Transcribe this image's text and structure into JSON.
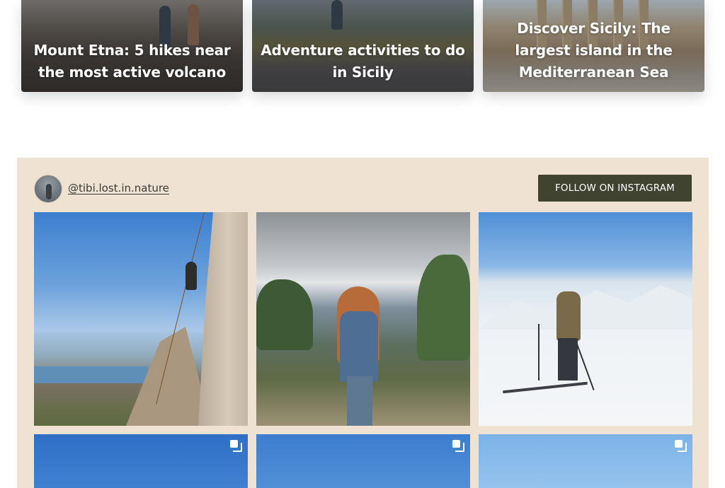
{
  "articles": [
    {
      "title": "Mount Etna: 5 hikes near the most active volcano"
    },
    {
      "title": "Adventure activities to do in Sicily"
    },
    {
      "title": "Discover Sicily: The largest island in the Mediterranean Sea"
    }
  ],
  "instagram": {
    "handle": "@tibi.lost.in.nature",
    "follow_label": "FOLLOW ON INSTAGRAM",
    "posts": [
      {
        "subject": "climber-on-rock",
        "multi": false
      },
      {
        "subject": "woman-long-hair-mountains",
        "multi": false
      },
      {
        "subject": "skier-in-snow",
        "multi": false
      },
      {
        "subject": "blue-sky",
        "multi": true
      },
      {
        "subject": "blue-sky",
        "multi": true
      },
      {
        "subject": "blue-sky",
        "multi": true
      }
    ]
  },
  "colors": {
    "section_bg": "#efe2d3",
    "button_bg": "#3f4330",
    "button_text": "#ffffff",
    "handle_text": "#3b3b36"
  },
  "icons": {
    "multi_post": "carousel-icon"
  }
}
